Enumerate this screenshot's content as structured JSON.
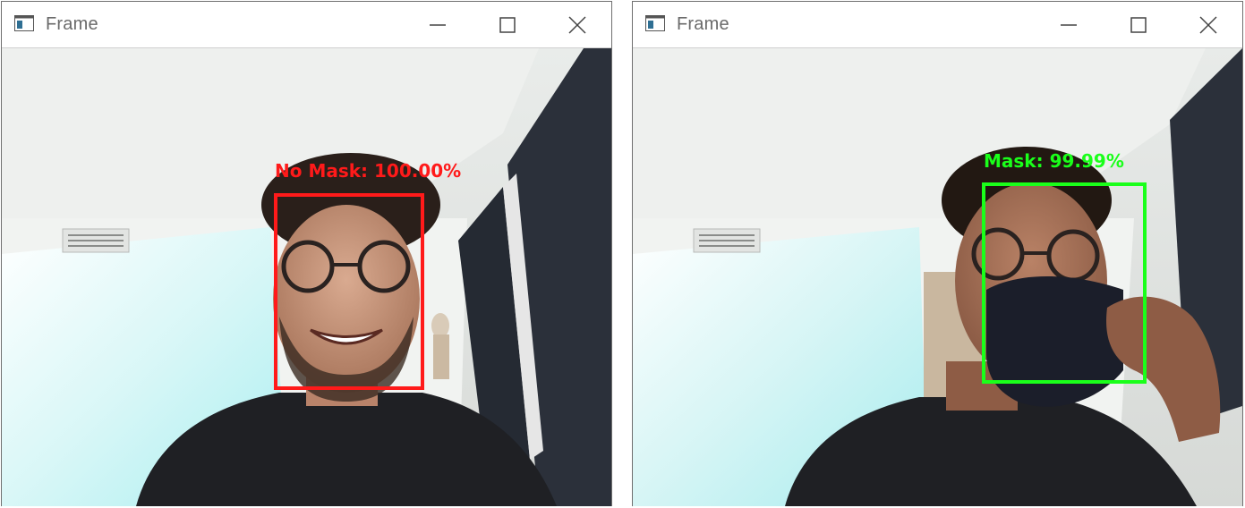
{
  "windows": [
    {
      "title": "Frame",
      "detection": {
        "label": "No Mask: 100.00%",
        "color": "#ff1a1a"
      }
    },
    {
      "title": "Frame",
      "detection": {
        "label": "Mask: 99.99%",
        "color": "#1aff1a"
      }
    }
  ],
  "icons": {
    "app": "app-window-icon",
    "minimize": "minimize-icon",
    "maximize": "maximize-icon",
    "close": "close-icon"
  }
}
